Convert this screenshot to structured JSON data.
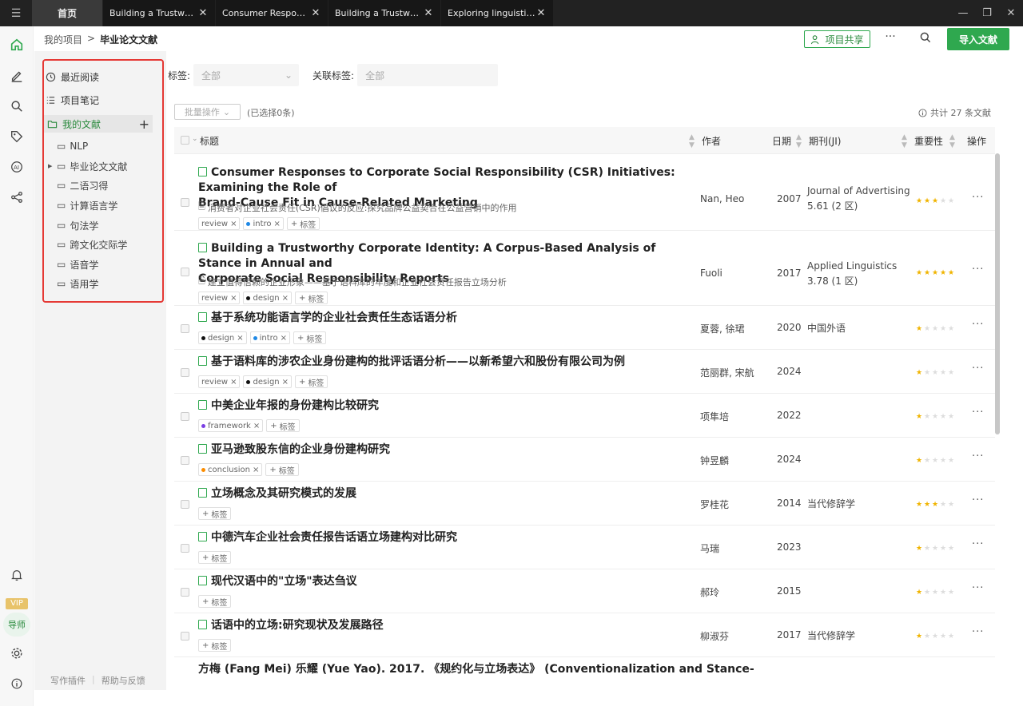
{
  "titlebar": {
    "tabs": [
      {
        "label": "首页"
      },
      {
        "label": "Building a Trustworthy Corporate Identity"
      },
      {
        "label": "Consumer Responses to Corporate Social Responsibility"
      },
      {
        "label": "Building a Trustworthy Corporate Identity"
      },
      {
        "label": "Exploring linguistic and cultural differences"
      }
    ],
    "close_glyph": "✕"
  },
  "breadcrumb": {
    "parent": "我的项目",
    "separator": ">",
    "current": "毕业论文文献"
  },
  "header": {
    "share_label": "项目共享",
    "more_label": "···",
    "import_label": "导入文献"
  },
  "sidebar": {
    "recent": "最近阅读",
    "notes": "项目笔记",
    "my_docs": "我的文献",
    "folders": [
      "NLP",
      "毕业论文文献",
      "二语习得",
      "计算语言学",
      "句法学",
      "跨文化交际学",
      "语音学",
      "语用学"
    ],
    "footer": {
      "plugin": "写作插件",
      "help": "帮助与反馈"
    }
  },
  "rail": {
    "vip": "VIP",
    "mentor": "导师"
  },
  "filters": {
    "tag_label": "标签:",
    "tag_value": "全部",
    "related_label": "关联标签:",
    "related_value": "全部"
  },
  "batch": {
    "label": "批量操作",
    "selected": "(已选择0条)",
    "total": "共计 27 条文献"
  },
  "table": {
    "headers": {
      "title": "标题",
      "author": "作者",
      "date": "日期",
      "journal": "期刊(JI)",
      "importance": "重要性",
      "ops": "操作"
    },
    "add_tag_label": "标签",
    "rows": [
      {
        "title_line1": "Consumer Responses to Corporate Social Responsibility (CSR) Initiatives: Examining the Role of",
        "title_line2": "Brand-Cause Fit in Cause-Related Marketing",
        "subtitle": "消费者对企业社会责任(CSR)倡议的反应:探究品牌公益契合在公益营销中的作用",
        "tags": [
          {
            "name": "review",
            "color": ""
          },
          {
            "name": "intro",
            "color": "#1e88e5"
          }
        ],
        "author": "Nan, Heo",
        "year": "2007",
        "journal_line1": "Journal of Advertising",
        "journal_line2": "5.61 (2 区)",
        "stars": 3
      },
      {
        "title_line1": "Building a Trustworthy Corporate Identity: A Corpus-Based Analysis of Stance in Annual and",
        "title_line2": "Corporate Social Responsibility Reports",
        "subtitle": "建立值得信赖的企业形象——基于语料库的年度和企业社会责任报告立场分析",
        "tags": [
          {
            "name": "review",
            "color": ""
          },
          {
            "name": "design",
            "color": "#111111"
          }
        ],
        "author": "Fuoli",
        "year": "2017",
        "journal_line1": "Applied Linguistics",
        "journal_line2": "3.78 (1 区)",
        "stars": 5
      },
      {
        "title_line1": "基于系统功能语言学的企业社会责任生态话语分析",
        "tags": [
          {
            "name": "design",
            "color": "#111111"
          },
          {
            "name": "intro",
            "color": "#1e88e5"
          }
        ],
        "author": "夏蓉, 徐珺",
        "year": "2020",
        "journal_line1": "中国外语",
        "stars": 1
      },
      {
        "title_line1": "基于语料库的涉农企业身份建构的批评话语分析——以新希望六和股份有限公司为例",
        "tags": [
          {
            "name": "review",
            "color": ""
          },
          {
            "name": "design",
            "color": "#111111"
          }
        ],
        "author": "范丽群, 宋航",
        "year": "2024",
        "stars": 1
      },
      {
        "title_line1": "中美企业年报的身份建构比较研究",
        "tags": [
          {
            "name": "framework",
            "color": "#7b3fe4"
          }
        ],
        "author": "项隼培",
        "year": "2022",
        "stars": 1
      },
      {
        "title_line1": "亚马逊致股东信的企业身份建构研究",
        "tags": [
          {
            "name": "conclusion",
            "color": "#fb8c00"
          }
        ],
        "author": "钟昱麟",
        "year": "2024",
        "stars": 1
      },
      {
        "title_line1": "立场概念及其研究模式的发展",
        "tags": [],
        "author": "罗桂花",
        "year": "2014",
        "journal_line1": "当代修辞学",
        "stars": 3
      },
      {
        "title_line1": "中德汽车企业社会责任报告话语立场建构对比研究",
        "tags": [],
        "author": "马瑞",
        "year": "2023",
        "stars": 1
      },
      {
        "title_line1": "现代汉语中的\"立场\"表达刍议",
        "tags": [],
        "author": "郝玲",
        "year": "2015",
        "stars": 1
      },
      {
        "title_line1": "话语中的立场:研究现状及发展路径",
        "tags": [],
        "author": "柳淑芬",
        "year": "2017",
        "journal_line1": "当代修辞学",
        "stars": 1
      },
      {
        "title_line1": "方梅 (Fang Mei) 乐耀 (Yue Yao). 2017. 《规约化与立场表达》 (Conventionalization and Stance-"
      }
    ]
  }
}
